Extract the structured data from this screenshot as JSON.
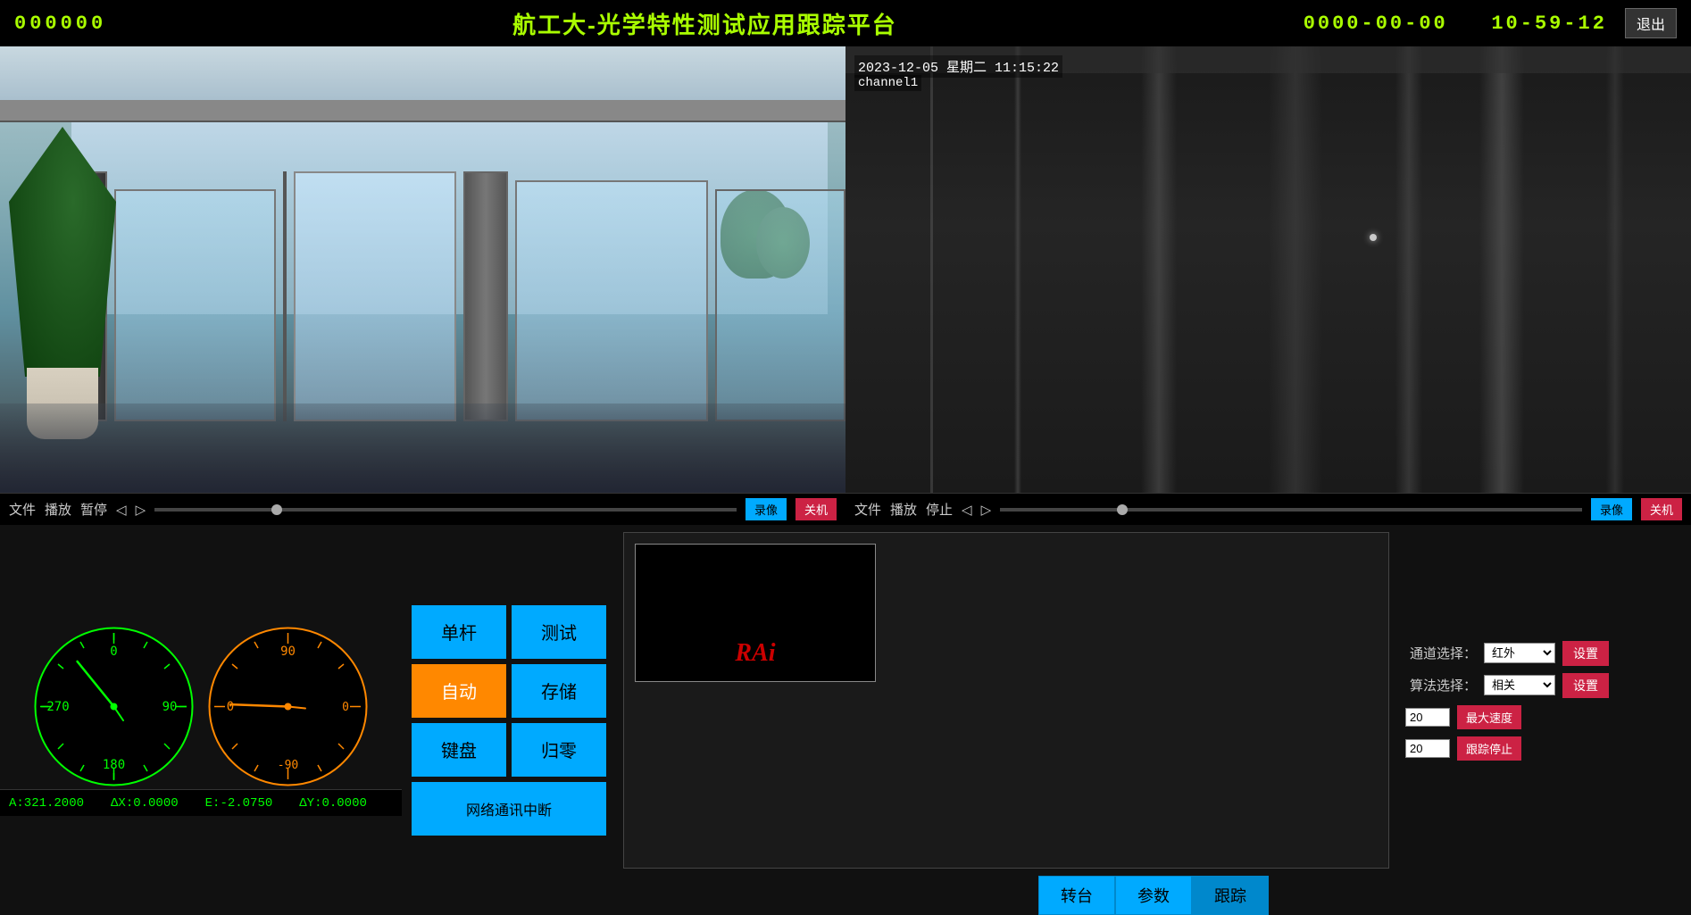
{
  "header": {
    "id_left": "000000",
    "title": "航工大-光学特性测试应用跟踪平台",
    "datetime_left": "0000-00-00",
    "datetime_right": "10-59-12",
    "exit_label": "退出"
  },
  "video_left": {
    "timestamp": "2023-12-05 星期二 11:15:22",
    "channel": "channel1"
  },
  "control_bar_left": {
    "file": "文件",
    "play": "播放",
    "pause": "暂停",
    "prev": "〈",
    "next": "〉",
    "record": "录像",
    "shutdown": "关机"
  },
  "control_bar_right": {
    "file": "文件",
    "play": "播放",
    "stop": "停止",
    "prev": "〈",
    "next": "〉",
    "record": "录像",
    "shutdown": "关机"
  },
  "gauges": {
    "left": {
      "label_a": "A:321.2000",
      "label_dx": "ΔX:0.0000"
    },
    "right": {
      "label_e": "E:-2.0750",
      "label_dy": "ΔY:0.0000"
    }
  },
  "control_buttons": {
    "single_rod": "单杆",
    "test": "测试",
    "auto": "自动",
    "save": "存储",
    "keyboard": "键盘",
    "reset": "归零",
    "network": "网络通讯中断"
  },
  "tracking_panel": {
    "rai_text": "RAi"
  },
  "right_control": {
    "channel_label": "通道选择：",
    "channel_value": "红外",
    "channel_set": "设置",
    "algo_label": "算法选择：",
    "algo_value": "相关",
    "algo_set": "设置",
    "input1_value": "20",
    "input2_value": "20",
    "max_speed": "最大速度",
    "track_stop": "跟踪停止"
  },
  "bottom_buttons": {
    "turntable": "转台",
    "params": "参数",
    "track": "跟踪"
  }
}
